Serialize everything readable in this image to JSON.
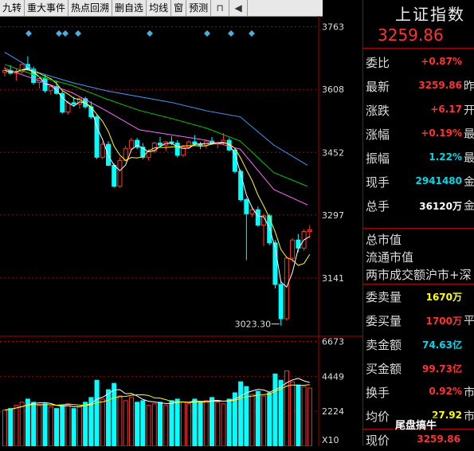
{
  "toolbar": {
    "items": [
      "九转",
      "重大事件",
      "热点回溯",
      "删自选",
      "均线",
      "窗",
      "预测"
    ],
    "icons": [
      "lock-icon",
      "pin-icon"
    ]
  },
  "chart_data": {
    "type": "candlestick",
    "y_axis_labels": [
      "3763",
      "3608",
      "3452",
      "3297",
      "3141"
    ],
    "ylim": [
      3040,
      3790
    ],
    "low_annotation": "3023.30",
    "volume_axis_labels": [
      "6673",
      "4449",
      "2224"
    ],
    "volume_unit": "X10",
    "colors": {
      "up": "#ff3232",
      "down": "#00ffff",
      "ma5": "#ffffff",
      "ma10": "#ffff00",
      "ma20": "#ff66ff",
      "ma30": "#00cc00",
      "ma60": "#4499ff",
      "grid": "#aa0000"
    },
    "candles": [
      [
        3650,
        3665,
        3640,
        3655
      ],
      [
        3655,
        3668,
        3645,
        3648
      ],
      [
        3648,
        3660,
        3630,
        3652
      ],
      [
        3652,
        3672,
        3648,
        3670
      ],
      [
        3670,
        3690,
        3655,
        3658
      ],
      [
        3658,
        3665,
        3620,
        3625
      ],
      [
        3625,
        3640,
        3610,
        3635
      ],
      [
        3635,
        3645,
        3600,
        3605
      ],
      [
        3605,
        3620,
        3595,
        3615
      ],
      [
        3615,
        3630,
        3595,
        3598
      ],
      [
        3598,
        3605,
        3548,
        3552
      ],
      [
        3552,
        3580,
        3545,
        3575
      ],
      [
        3575,
        3590,
        3568,
        3572
      ],
      [
        3572,
        3588,
        3560,
        3585
      ],
      [
        3585,
        3590,
        3560,
        3565
      ],
      [
        3565,
        3578,
        3535,
        3540
      ],
      [
        3540,
        3545,
        3435,
        3440
      ],
      [
        3440,
        3478,
        3435,
        3472
      ],
      [
        3472,
        3480,
        3418,
        3420
      ],
      [
        3420,
        3425,
        3365,
        3368
      ],
      [
        3368,
        3440,
        3365,
        3432
      ],
      [
        3432,
        3468,
        3428,
        3462
      ],
      [
        3462,
        3488,
        3455,
        3482
      ],
      [
        3482,
        3488,
        3460,
        3465
      ],
      [
        3465,
        3475,
        3435,
        3440
      ],
      [
        3440,
        3460,
        3432,
        3455
      ],
      [
        3455,
        3478,
        3450,
        3475
      ],
      [
        3475,
        3490,
        3468,
        3470
      ],
      [
        3470,
        3480,
        3455,
        3478
      ],
      [
        3478,
        3492,
        3470,
        3475
      ],
      [
        3475,
        3482,
        3440,
        3445
      ],
      [
        3445,
        3470,
        3440,
        3465
      ],
      [
        3465,
        3482,
        3460,
        3478
      ],
      [
        3478,
        3495,
        3470,
        3472
      ],
      [
        3472,
        3478,
        3460,
        3470
      ],
      [
        3470,
        3482,
        3462,
        3480
      ],
      [
        3480,
        3490,
        3470,
        3473
      ],
      [
        3473,
        3478,
        3462,
        3475
      ],
      [
        3475,
        3500,
        3470,
        3482
      ],
      [
        3482,
        3488,
        3455,
        3458
      ],
      [
        3458,
        3462,
        3400,
        3405
      ],
      [
        3405,
        3410,
        3330,
        3335
      ],
      [
        3335,
        3340,
        3185,
        3300
      ],
      [
        3300,
        3318,
        3292,
        3310
      ],
      [
        3310,
        3318,
        3268,
        3272
      ],
      [
        3272,
        3300,
        3220,
        3295
      ],
      [
        3295,
        3300,
        3222,
        3228
      ],
      [
        3228,
        3235,
        3115,
        3125
      ],
      [
        3125,
        3135,
        3023,
        3040
      ],
      [
        3040,
        3195,
        3035,
        3190
      ],
      [
        3190,
        3240,
        3180,
        3235
      ],
      [
        3235,
        3250,
        3205,
        3215
      ],
      [
        3215,
        3262,
        3208,
        3256
      ],
      [
        3256,
        3272,
        3240,
        3260
      ]
    ],
    "volumes": [
      2300,
      2400,
      2600,
      2800,
      3000,
      2800,
      2600,
      2700,
      2500,
      2400,
      2600,
      2700,
      2400,
      2500,
      2800,
      3100,
      4200,
      3000,
      3600,
      4000,
      3200,
      2900,
      3100,
      2800,
      2900,
      2600,
      2700,
      2800,
      2600,
      2900,
      3000,
      2800,
      2700,
      3000,
      2800,
      2900,
      3100,
      2800,
      2700,
      3000,
      3400,
      4100,
      3800,
      3300,
      3500,
      3200,
      3400,
      4600,
      4200,
      4800,
      4100,
      3900,
      3800,
      3700
    ],
    "ma_lines": {
      "ma60": [
        3700,
        3650,
        3625,
        3605,
        3590,
        3575,
        3555,
        3540,
        3470,
        3420
      ],
      "ma30": [
        3670,
        3640,
        3618,
        3585,
        3556,
        3535,
        3512,
        3480,
        3402,
        3368
      ],
      "ma20": [
        3660,
        3630,
        3600,
        3556,
        3508,
        3495,
        3482,
        3460,
        3360,
        3322
      ]
    }
  },
  "panel": {
    "title": "上证指数",
    "price": "3259.86",
    "rows": [
      {
        "label": "委比",
        "value": "+0.87%",
        "color": "red",
        "tail": ""
      },
      {
        "label": "最新",
        "value": "3259.86",
        "color": "red",
        "tail": "昨"
      },
      {
        "label": "涨跌",
        "value": "+6.17",
        "color": "red",
        "tail": "开"
      },
      {
        "label": "涨幅",
        "value": "+0.19%",
        "color": "red",
        "tail": "最"
      },
      {
        "label": "振幅",
        "value": "1.22%",
        "color": "cyan",
        "tail": "最"
      },
      {
        "label": "现手",
        "value": "2941480",
        "color": "cyan",
        "tail": "金"
      },
      {
        "label": "总手",
        "value": "36120万",
        "color": "wht",
        "tail": "金"
      }
    ],
    "plain": [
      "总市值",
      "流通市值",
      "两市成交额沪市+深"
    ],
    "rows2": [
      {
        "label": "委卖量",
        "value": "1670万",
        "color": "yel",
        "tail": ""
      },
      {
        "label": "委买量",
        "value": "1700万",
        "color": "red",
        "tail": "平"
      },
      {
        "label": "卖金额",
        "value": "74.63亿",
        "color": "cyan",
        "tail": ""
      },
      {
        "label": "买金额",
        "value": "99.73亿",
        "color": "red",
        "tail": ""
      },
      {
        "label": "换手",
        "value": "0.92%",
        "color": "red",
        "tail": "市"
      },
      {
        "label": "均价",
        "value": "27.92",
        "color": "yel",
        "tail": "市"
      }
    ],
    "bottom_label": "现价",
    "bottom_value": "3259.86"
  },
  "watermark": "尾盘搞牛"
}
